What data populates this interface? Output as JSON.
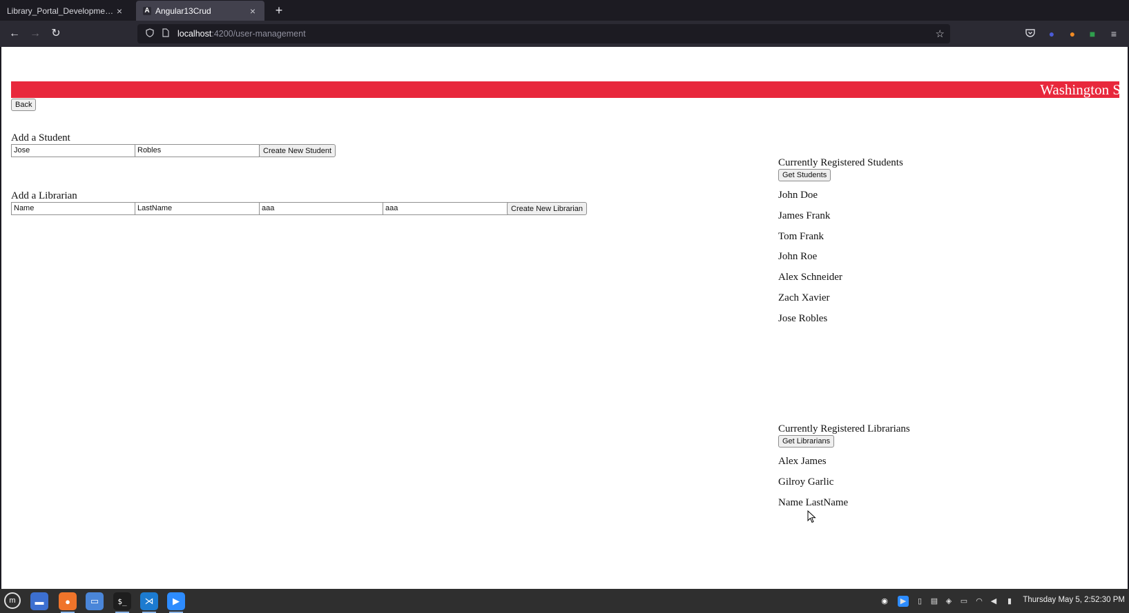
{
  "browser": {
    "tabs": [
      {
        "title": "Library_Portal_Development_S",
        "active": false
      },
      {
        "title": "Angular13Crud",
        "active": true,
        "favicon": "A"
      }
    ],
    "url_host": "localhost",
    "url_path": ":4200/user-management",
    "icons": {
      "back": "arrow-left-icon",
      "forward": "arrow-right-icon",
      "reload": "reload-icon",
      "bookmark": "star-icon",
      "pocket": "pocket-icon",
      "extensions": [
        "extension-icon",
        "fox-extension-icon",
        "green-extension-icon"
      ],
      "menu": "hamburger-menu-icon"
    }
  },
  "page": {
    "banner_text": "Washington S",
    "banner_color": "#e8283c",
    "back_label": "Back",
    "student_form": {
      "heading": "Add a Student",
      "first_name": "Jose",
      "last_name": "Robles",
      "submit_label": "Create New Student"
    },
    "librarian_form": {
      "heading": "Add a Librarian",
      "first_name": "Name",
      "last_name": "LastName",
      "field3": "aaa",
      "field4": "aaa",
      "submit_label": "Create New Librarian"
    },
    "students": {
      "heading": "Currently Registered Students",
      "button_label": "Get Students",
      "items": [
        "John Doe",
        "James Frank",
        "Tom Frank",
        "John Roe",
        "Alex Schneider",
        "Zach Xavier",
        "Jose Robles"
      ]
    },
    "librarians": {
      "heading": "Currently Registered Librarians",
      "button_label": "Get Librarians",
      "items": [
        "Alex James",
        "Gilroy Garlic",
        "Name LastName"
      ]
    }
  },
  "taskbar": {
    "clock": "Thursday May 5, 2:52:30 PM",
    "apps": [
      "menu-icon",
      "file-manager-icon",
      "firefox-icon",
      "folder-icon",
      "terminal-icon",
      "vscode-icon",
      "zoom-icon"
    ]
  }
}
